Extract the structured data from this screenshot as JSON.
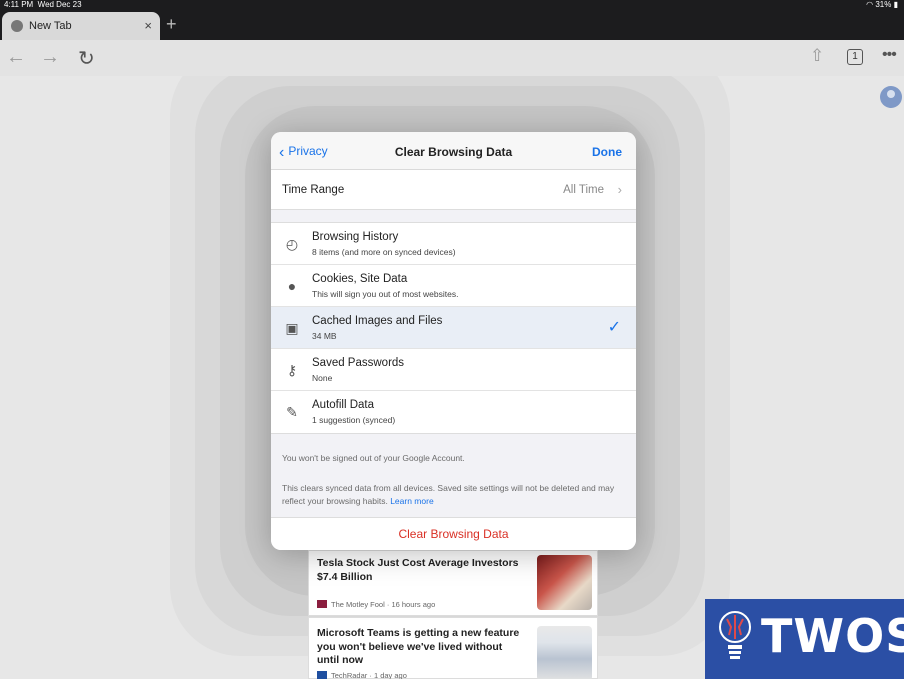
{
  "status_bar": {
    "time": "4:11 PM",
    "date": "Wed Dec 23",
    "battery": "31%"
  },
  "tab": {
    "title": "New Tab",
    "close_glyph": "×",
    "new_tab_glyph": "+"
  },
  "toolbar": {
    "back_glyph": "←",
    "forward_glyph": "→",
    "reload_glyph": "↻",
    "share_glyph": "⇧",
    "tab_count": "1",
    "menu_glyph": "•••"
  },
  "feed": [
    {
      "title": "Tesla Stock Just Cost Average Investors $7.4 Billion",
      "source": "The Motley Fool",
      "age": "16 hours ago",
      "source_color": "#8b1e3f"
    },
    {
      "title": "Microsoft Teams is getting a new feature you won't believe we've lived without until now",
      "source": "TechRadar",
      "age": "1 day ago",
      "source_color": "#1f4fa0"
    }
  ],
  "dialog": {
    "back_label": "Privacy",
    "title": "Clear Browsing Data",
    "done_label": "Done",
    "time_range": {
      "label": "Time Range",
      "value": "All Time"
    },
    "items": [
      {
        "title": "Browsing History",
        "subtitle": "8 items (and more on synced devices)",
        "icon": "history-icon",
        "selected": false
      },
      {
        "title": "Cookies, Site Data",
        "subtitle": "This will sign you out of most websites.",
        "icon": "cookie-icon",
        "selected": false
      },
      {
        "title": "Cached Images and Files",
        "subtitle": "34 MB",
        "icon": "image-icon",
        "selected": true
      },
      {
        "title": "Saved Passwords",
        "subtitle": "None",
        "icon": "key-icon",
        "selected": false
      },
      {
        "title": "Autofill Data",
        "subtitle": "1 suggestion (synced)",
        "icon": "magic-wand-icon",
        "selected": false
      }
    ],
    "note_account": "You won't be signed out of your Google Account.",
    "note_sync": "This clears synced data from all devices. Saved site settings will not be deleted and may reflect your browsing habits.",
    "learn_more": "Learn more",
    "clear_button": "Clear Browsing Data"
  },
  "watermark": {
    "text": "TWOS"
  },
  "colors": {
    "accent_blue": "#1a73e8",
    "destructive_red": "#d93025",
    "watermark_bg": "#2b4fa5"
  }
}
